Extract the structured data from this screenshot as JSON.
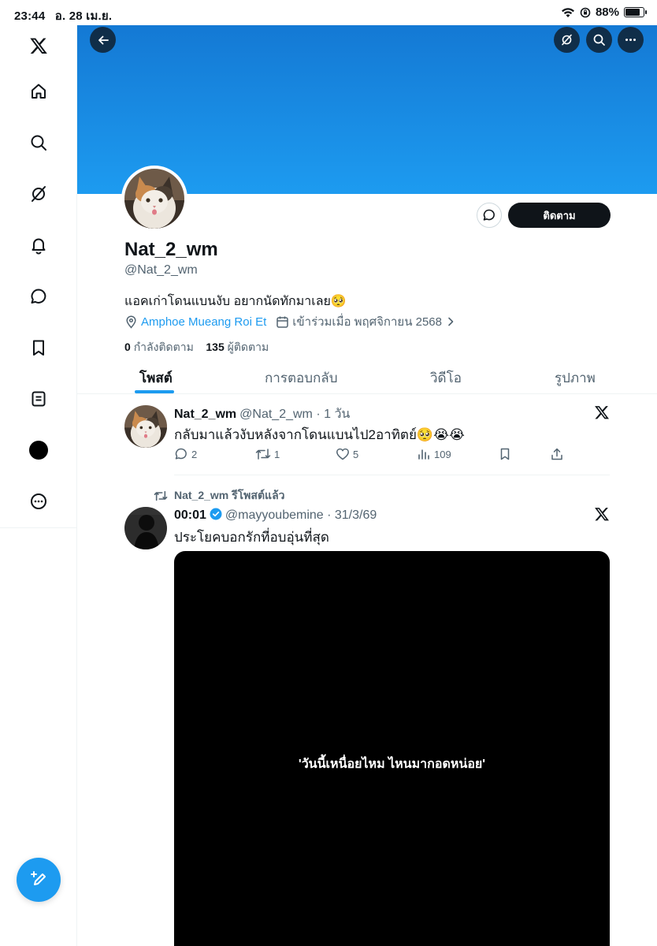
{
  "status_bar": {
    "time": "23:44",
    "date": "อ. 28 เม.ย.",
    "battery": "88%",
    "battery_level": 0.88
  },
  "nav": {
    "items": [
      "x-logo-icon",
      "home-icon",
      "search-icon",
      "grok-icon",
      "notifications-icon",
      "messages-icon",
      "bookmarks-icon",
      "lists-icon",
      "profile-icon",
      "more-icon"
    ]
  },
  "profile": {
    "display_name": "Nat_2_wm",
    "handle": "@Nat_2_wm",
    "bio": "แอคเก่าโดนแบนงับ อยากนัดทักมาเลย🥺",
    "location": "Amphoe Mueang Roi Et",
    "joined": "เข้าร่วมเมื่อ พฤศจิกายน 2568",
    "following_count": "0",
    "following_label": "กำลังติดตาม",
    "followers_count": "135",
    "followers_label": "ผู้ติดตาม",
    "follow_button": "ติดตาม"
  },
  "tabs": [
    {
      "label": "โพสต์",
      "active": true
    },
    {
      "label": "การตอบกลับ",
      "active": false
    },
    {
      "label": "วิดีโอ",
      "active": false
    },
    {
      "label": "รูปภาพ",
      "active": false
    }
  ],
  "tweets": [
    {
      "name": "Nat_2_wm",
      "handle_time": "@Nat_2_wm · 1 วัน",
      "text": "กลับมาแล้วงับหลังจากโดนแบนไป2อาทิตย์🥺😭😭",
      "replies": "2",
      "reposts": "1",
      "likes": "5",
      "views": "109"
    },
    {
      "repost_label": "Nat_2_wm รีโพสต์แล้ว",
      "name": "00:01",
      "handle_time": "@mayyoubemine · 31/3/69",
      "text": "ประโยคบอกรักที่อบอุ่นที่สุด",
      "video_caption": "'วันนี้เหนื่อยไหม ไหนมากอดหน่อย'"
    }
  ],
  "colors": {
    "accent": "#1d9bf0",
    "text": "#0f1419",
    "secondary": "#536471",
    "banner_top": "#1479d4",
    "banner_bottom": "#1d9bf0"
  }
}
